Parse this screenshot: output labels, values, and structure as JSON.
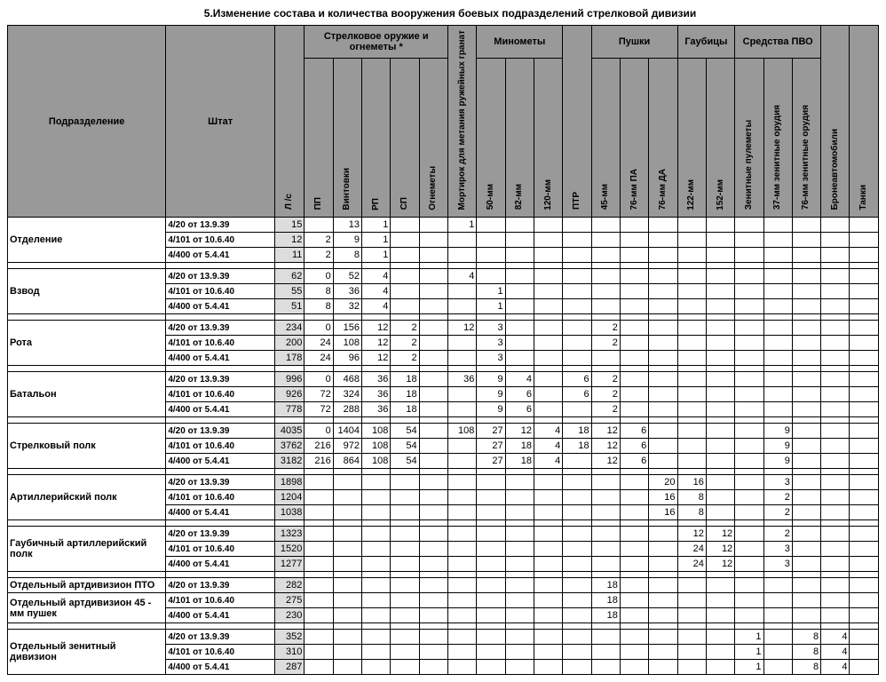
{
  "title": "5.Изменение состава и количества вооружения боевых подразделений стрелковой дивизии",
  "headers": {
    "unit": "Подразделение",
    "shtat": "Штат",
    "ls": "Л /с",
    "grp_small_arms": "Стрелковое оружие и огнеметы *",
    "pp": "ПП",
    "vintovki": "Винтовки",
    "rp": "РП",
    "sp": "СП",
    "ognemety": "Огнеметы",
    "mortirok": "Мортирок для метания ружейных гранат",
    "grp_minomety": "Минометы",
    "m50": "50-мм",
    "m82": "82-мм",
    "m120": "120-мм",
    "ptr": "ПТР",
    "grp_pushki": "Пушки",
    "p45": "45-мм",
    "p76pa": "76-мм ПА",
    "p76da": "76-мм ДА",
    "grp_gaubitsy": "Гаубицы",
    "g122": "122-мм",
    "g152": "152-мм",
    "grp_pvo": "Средства ПВО",
    "zen_pulem": "Зенитные пулеметы",
    "z37": "37-мм зенитные орудия",
    "z76": "76-мм зенитные орудия",
    "bronev": "Бронеавтомобили",
    "tanki": "Танки"
  },
  "groups": [
    {
      "unit": "Отделение",
      "rows": [
        {
          "shtat": "4/20   от 13.9.39",
          "ls": "15",
          "vals": [
            "",
            "13",
            "1",
            "",
            "",
            "1",
            "",
            "",
            "",
            "",
            "",
            "",
            "",
            "",
            "",
            "",
            "",
            "",
            "",
            ""
          ]
        },
        {
          "shtat": "4/101 от 10.6.40",
          "ls": "12",
          "vals": [
            "2",
            "9",
            "1",
            "",
            "",
            "",
            "",
            "",
            "",
            "",
            "",
            "",
            "",
            "",
            "",
            "",
            "",
            "",
            "",
            ""
          ]
        },
        {
          "shtat": "4/400 от 5.4.41",
          "ls": "11",
          "vals": [
            "2",
            "8",
            "1",
            "",
            "",
            "",
            "",
            "",
            "",
            "",
            "",
            "",
            "",
            "",
            "",
            "",
            "",
            "",
            "",
            ""
          ]
        }
      ]
    },
    {
      "unit": "Взвод",
      "rows": [
        {
          "shtat": "4/20   от 13.9.39",
          "ls": "62",
          "vals": [
            "0",
            "52",
            "4",
            "",
            "",
            "4",
            "",
            "",
            "",
            "",
            "",
            "",
            "",
            "",
            "",
            "",
            "",
            "",
            "",
            ""
          ]
        },
        {
          "shtat": "4/101 от 10.6.40",
          "ls": "55",
          "vals": [
            "8",
            "36",
            "4",
            "",
            "",
            "",
            "1",
            "",
            "",
            "",
            "",
            "",
            "",
            "",
            "",
            "",
            "",
            "",
            "",
            ""
          ]
        },
        {
          "shtat": "4/400 от 5.4.41",
          "ls": "51",
          "vals": [
            "8",
            "32",
            "4",
            "",
            "",
            "",
            "1",
            "",
            "",
            "",
            "",
            "",
            "",
            "",
            "",
            "",
            "",
            "",
            "",
            ""
          ]
        }
      ]
    },
    {
      "unit": "Рота",
      "rows": [
        {
          "shtat": "4/20   от 13.9.39",
          "ls": "234",
          "vals": [
            "0",
            "156",
            "12",
            "2",
            "",
            "12",
            "3",
            "",
            "",
            "",
            "2",
            "",
            "",
            "",
            "",
            "",
            "",
            "",
            "",
            ""
          ]
        },
        {
          "shtat": "4/101 от 10.6.40",
          "ls": "200",
          "vals": [
            "24",
            "108",
            "12",
            "2",
            "",
            "",
            "3",
            "",
            "",
            "",
            "2",
            "",
            "",
            "",
            "",
            "",
            "",
            "",
            "",
            ""
          ]
        },
        {
          "shtat": "4/400 от 5.4.41",
          "ls": "178",
          "vals": [
            "24",
            "96",
            "12",
            "2",
            "",
            "",
            "3",
            "",
            "",
            "",
            "",
            "",
            "",
            "",
            "",
            "",
            "",
            "",
            "",
            ""
          ]
        }
      ]
    },
    {
      "unit": "Батальон",
      "rows": [
        {
          "shtat": "4/20   от 13.9.39",
          "ls": "996",
          "vals": [
            "0",
            "468",
            "36",
            "18",
            "",
            "36",
            "9",
            "4",
            "",
            "6",
            "2",
            "",
            "",
            "",
            "",
            "",
            "",
            "",
            "",
            ""
          ]
        },
        {
          "shtat": "4/101 от 10.6.40",
          "ls": "926",
          "vals": [
            "72",
            "324",
            "36",
            "18",
            "",
            "",
            "9",
            "6",
            "",
            "6",
            "2",
            "",
            "",
            "",
            "",
            "",
            "",
            "",
            "",
            ""
          ]
        },
        {
          "shtat": "4/400 от 5.4.41",
          "ls": "778",
          "vals": [
            "72",
            "288",
            "36",
            "18",
            "",
            "",
            "9",
            "6",
            "",
            "",
            "2",
            "",
            "",
            "",
            "",
            "",
            "",
            "",
            "",
            ""
          ]
        }
      ]
    },
    {
      "unit": "Стрелковый полк",
      "rows": [
        {
          "shtat": "4/20   от 13.9.39",
          "ls": "4035",
          "vals": [
            "0",
            "1404",
            "108",
            "54",
            "",
            "108",
            "27",
            "12",
            "4",
            "18",
            "12",
            "6",
            "",
            "",
            "",
            "",
            "9",
            "",
            "",
            ""
          ]
        },
        {
          "shtat": "4/101 от 10.6.40",
          "ls": "3762",
          "vals": [
            "216",
            "972",
            "108",
            "54",
            "",
            "",
            "27",
            "18",
            "4",
            "18",
            "12",
            "6",
            "",
            "",
            "",
            "",
            "9",
            "",
            "",
            ""
          ]
        },
        {
          "shtat": "4/400 от 5.4.41",
          "ls": "3182",
          "vals": [
            "216",
            "864",
            "108",
            "54",
            "",
            "",
            "27",
            "18",
            "4",
            "",
            "12",
            "6",
            "",
            "",
            "",
            "",
            "9",
            "",
            "",
            ""
          ]
        }
      ]
    },
    {
      "unit": "Артиллерийский полк",
      "rows": [
        {
          "shtat": "4/20   от 13.9.39",
          "ls": "1898",
          "vals": [
            "",
            "",
            "",
            "",
            "",
            "",
            "",
            "",
            "",
            "",
            "",
            "",
            "20",
            "16",
            "",
            "",
            "3",
            "",
            "",
            ""
          ]
        },
        {
          "shtat": "4/101 от 10.6.40",
          "ls": "1204",
          "vals": [
            "",
            "",
            "",
            "",
            "",
            "",
            "",
            "",
            "",
            "",
            "",
            "",
            "16",
            "8",
            "",
            "",
            "2",
            "",
            "",
            ""
          ]
        },
        {
          "shtat": "4/400 от 5.4.41",
          "ls": "1038",
          "vals": [
            "",
            "",
            "",
            "",
            "",
            "",
            "",
            "",
            "",
            "",
            "",
            "",
            "16",
            "8",
            "",
            "",
            "2",
            "",
            "",
            ""
          ]
        }
      ]
    },
    {
      "unit": "Гаубичный артиллерийский полк",
      "rows": [
        {
          "shtat": "4/20   от 13.9.39",
          "ls": "1323",
          "vals": [
            "",
            "",
            "",
            "",
            "",
            "",
            "",
            "",
            "",
            "",
            "",
            "",
            "",
            "12",
            "12",
            "",
            "2",
            "",
            "",
            ""
          ]
        },
        {
          "shtat": "4/101 от 10.6.40",
          "ls": "1520",
          "vals": [
            "",
            "",
            "",
            "",
            "",
            "",
            "",
            "",
            "",
            "",
            "",
            "",
            "",
            "24",
            "12",
            "",
            "3",
            "",
            "",
            ""
          ]
        },
        {
          "shtat": "4/400 от 5.4.41",
          "ls": "1277",
          "vals": [
            "",
            "",
            "",
            "",
            "",
            "",
            "",
            "",
            "",
            "",
            "",
            "",
            "",
            "24",
            "12",
            "",
            "3",
            "",
            "",
            ""
          ]
        }
      ]
    },
    {
      "unit": "Отдельный артдивизион ПТО",
      "rows": [
        {
          "shtat": "4/20   от 13.9.39",
          "ls": "282",
          "vals": [
            "",
            "",
            "",
            "",
            "",
            "",
            "",
            "",
            "",
            "",
            "18",
            "",
            "",
            "",
            "",
            "",
            "",
            "",
            "",
            ""
          ]
        }
      ]
    },
    {
      "unit": "Отдельный артдивизион 45 - мм пушек",
      "nosep": true,
      "rows": [
        {
          "shtat": "4/101 от 10.6.40",
          "ls": "275",
          "vals": [
            "",
            "",
            "",
            "",
            "",
            "",
            "",
            "",
            "",
            "",
            "18",
            "",
            "",
            "",
            "",
            "",
            "",
            "",
            "",
            ""
          ]
        },
        {
          "shtat": "4/400 от 5.4.41",
          "ls": "230",
          "vals": [
            "",
            "",
            "",
            "",
            "",
            "",
            "",
            "",
            "",
            "",
            "18",
            "",
            "",
            "",
            "",
            "",
            "",
            "",
            "",
            ""
          ]
        }
      ]
    },
    {
      "unit": "Отдельный зенитный дивизион",
      "rows": [
        {
          "shtat": "4/20   от 13.9.39",
          "ls": "352",
          "vals": [
            "",
            "",
            "",
            "",
            "",
            "",
            "",
            "",
            "",
            "",
            "",
            "",
            "",
            "",
            "",
            "1",
            "",
            "8",
            "4",
            ""
          ]
        },
        {
          "shtat": "4/101 от 10.6.40",
          "ls": "310",
          "vals": [
            "",
            "",
            "",
            "",
            "",
            "",
            "",
            "",
            "",
            "",
            "",
            "",
            "",
            "",
            "",
            "1",
            "",
            "8",
            "4",
            ""
          ]
        },
        {
          "shtat": "4/400 от 5.4.41",
          "ls": "287",
          "vals": [
            "",
            "",
            "",
            "",
            "",
            "",
            "",
            "",
            "",
            "",
            "",
            "",
            "",
            "",
            "",
            "1",
            "",
            "8",
            "4",
            ""
          ]
        }
      ]
    }
  ]
}
